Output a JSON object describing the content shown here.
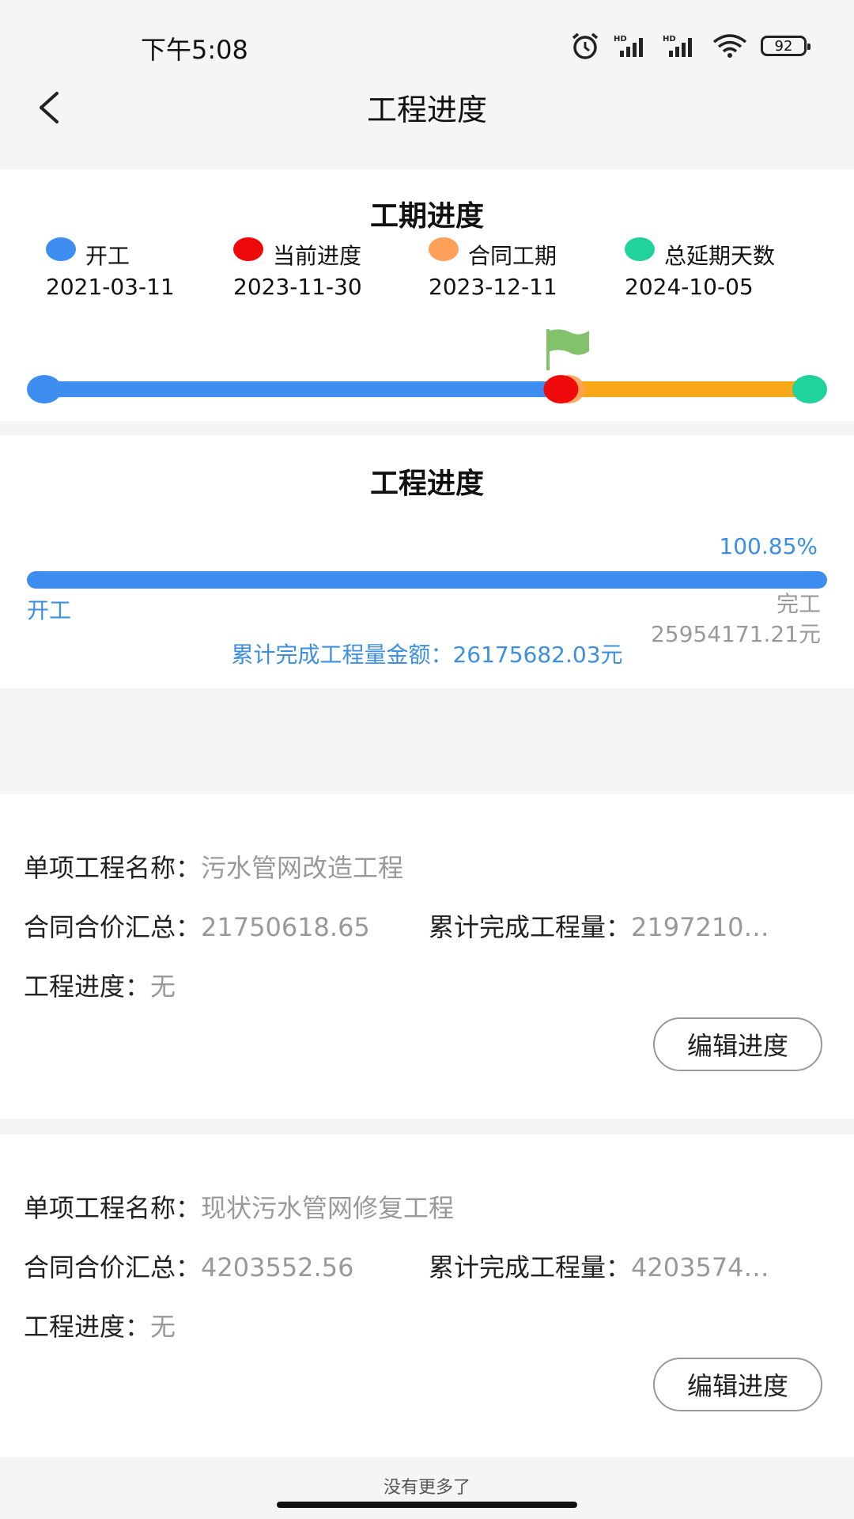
{
  "status_bar": {
    "time": "下午5:08",
    "battery": "92",
    "icons": [
      "alarm-icon",
      "hd-signal-icon",
      "hd-signal-icon",
      "wifi-icon",
      "battery-icon"
    ]
  },
  "nav": {
    "title": "工程进度",
    "back_icon": "chevron-left-icon"
  },
  "schedule": {
    "title": "工期进度",
    "legend": [
      {
        "label": "开工",
        "date": "2021-03-11",
        "color": "#3d8ef0"
      },
      {
        "label": "当前进度",
        "date": "2023-11-30",
        "color": "#ee0a0a"
      },
      {
        "label": "合同工期",
        "date": "2023-12-11",
        "color": "#ffa05a"
      },
      {
        "label": "总延期天数",
        "date": "2024-10-05",
        "color": "#20d39a"
      }
    ],
    "timeline": {
      "current_fraction": 0.675,
      "track_color": "#3d8ef0",
      "delay_color": "#f9a81a",
      "flag_color": "#82c26b",
      "flag_icon": "flag-icon"
    }
  },
  "progress": {
    "title": "工程进度",
    "percent": "100.85%",
    "fill_fraction": 1.0,
    "start_label": "开工",
    "end_label": "完工",
    "end_amount": "25954171.21元",
    "cumulative": "累计完成工程量金额：26175682.03元"
  },
  "items": [
    {
      "name_label": "单项工程名称：",
      "name_value": "污水管网改造工程",
      "price_label": "合同合价汇总：",
      "price_value": "21750618.65",
      "done_label": "累计完成工程量：",
      "done_value": "2197210…",
      "progress_label": "工程进度：",
      "progress_value": "无",
      "edit_label": "编辑进度"
    },
    {
      "name_label": "单项工程名称：",
      "name_value": "现状污水管网修复工程",
      "price_label": "合同合价汇总：",
      "price_value": "4203552.56",
      "done_label": "累计完成工程量：",
      "done_value": "4203574…",
      "progress_label": "工程进度：",
      "progress_value": "无",
      "edit_label": "编辑进度"
    }
  ],
  "footer": {
    "no_more": "没有更多了"
  }
}
